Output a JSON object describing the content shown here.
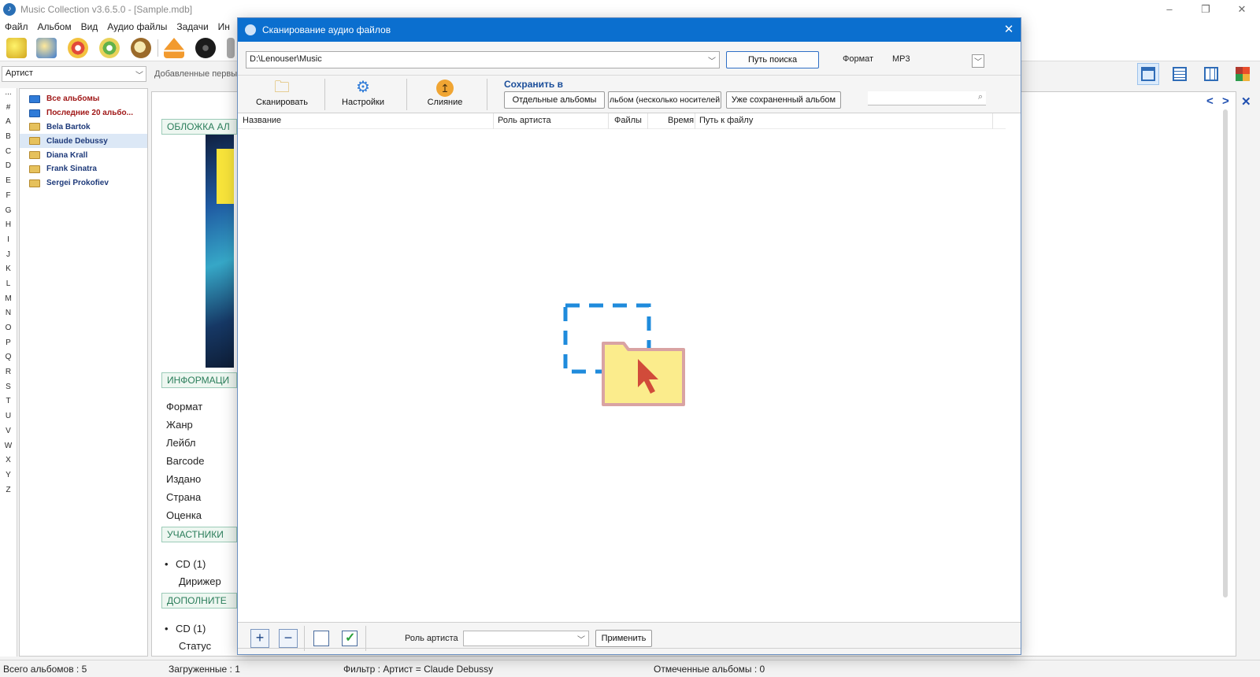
{
  "window": {
    "title": "Music Collection v3.6.5.0 - [Sample.mdb]",
    "controls": [
      "–",
      "❐",
      "✕"
    ]
  },
  "menu": [
    "Файл",
    "Альбом",
    "Вид",
    "Аудио файлы",
    "Задачи",
    "Ин"
  ],
  "filter": {
    "field": "Артист",
    "sort_hint": "Добавленные первы"
  },
  "letters": [
    "...",
    "#",
    "A",
    "B",
    "C",
    "D",
    "E",
    "F",
    "G",
    "H",
    "I",
    "J",
    "K",
    "L",
    "M",
    "N",
    "O",
    "P",
    "Q",
    "R",
    "S",
    "T",
    "U",
    "V",
    "W",
    "X",
    "Y",
    "Z"
  ],
  "tree": [
    {
      "label": "Все альбомы",
      "kind": "special"
    },
    {
      "label": "Последние 20 альбо...",
      "kind": "special"
    },
    {
      "label": "Bela Bartok",
      "kind": "artist"
    },
    {
      "label": "Claude Debussy",
      "kind": "artist",
      "selected": true
    },
    {
      "label": "Diana Krall",
      "kind": "artist"
    },
    {
      "label": "Frank Sinatra",
      "kind": "artist"
    },
    {
      "label": "Sergei Prokofiev",
      "kind": "artist"
    }
  ],
  "detail": {
    "cover_header": "ОБЛОЖКА АЛ",
    "info_header": "ИНФОРМАЦИ",
    "info_labels": [
      "Формат",
      "Жанр",
      "Лейбл",
      "Barcode",
      "Издано",
      "Страна",
      "Оценка"
    ],
    "members_header": "УЧАСТНИКИ",
    "members": {
      "item": "CD (1)",
      "role": "Дирижер"
    },
    "extra_header": "ДОПОЛНИТЕ",
    "extra": {
      "item": "CD (1)",
      "role": "Статус"
    },
    "nav": {
      "prev": "<",
      "next": ">",
      "close": "✕"
    }
  },
  "status": {
    "total": "Всего альбомов : 5",
    "loaded": "Загруженные : 1",
    "filter": "Фильтр : Артист = Claude Debussy",
    "marked": "Отмеченные альбомы : 0"
  },
  "dialog": {
    "title": "Сканирование аудио файлов",
    "path": "D:\\Lenouser\\Music",
    "search_path_button": "Путь поиска",
    "format_label": "Формат",
    "format_value": "MP3",
    "toolbar": {
      "scan": "Сканировать",
      "settings": "Настройки",
      "merge": "Слияние"
    },
    "save_in": {
      "title": "Сохранить в",
      "separate": "Отдельные альбомы",
      "multi": "льбом (несколько носителей",
      "existing": "Уже сохраненный альбом"
    },
    "columns": [
      "Название",
      "Роль артиста",
      "Файлы",
      "Время",
      "Путь к файлу"
    ],
    "bottom": {
      "add": "+",
      "remove": "−",
      "role_label": "Роль артиста",
      "apply": "Применить"
    }
  },
  "colors": {
    "dialog_title": "#0b6fcf",
    "accent_green": "#2a7d5a",
    "tree_link": "#1e3a7a",
    "tree_special": "#a01818"
  }
}
